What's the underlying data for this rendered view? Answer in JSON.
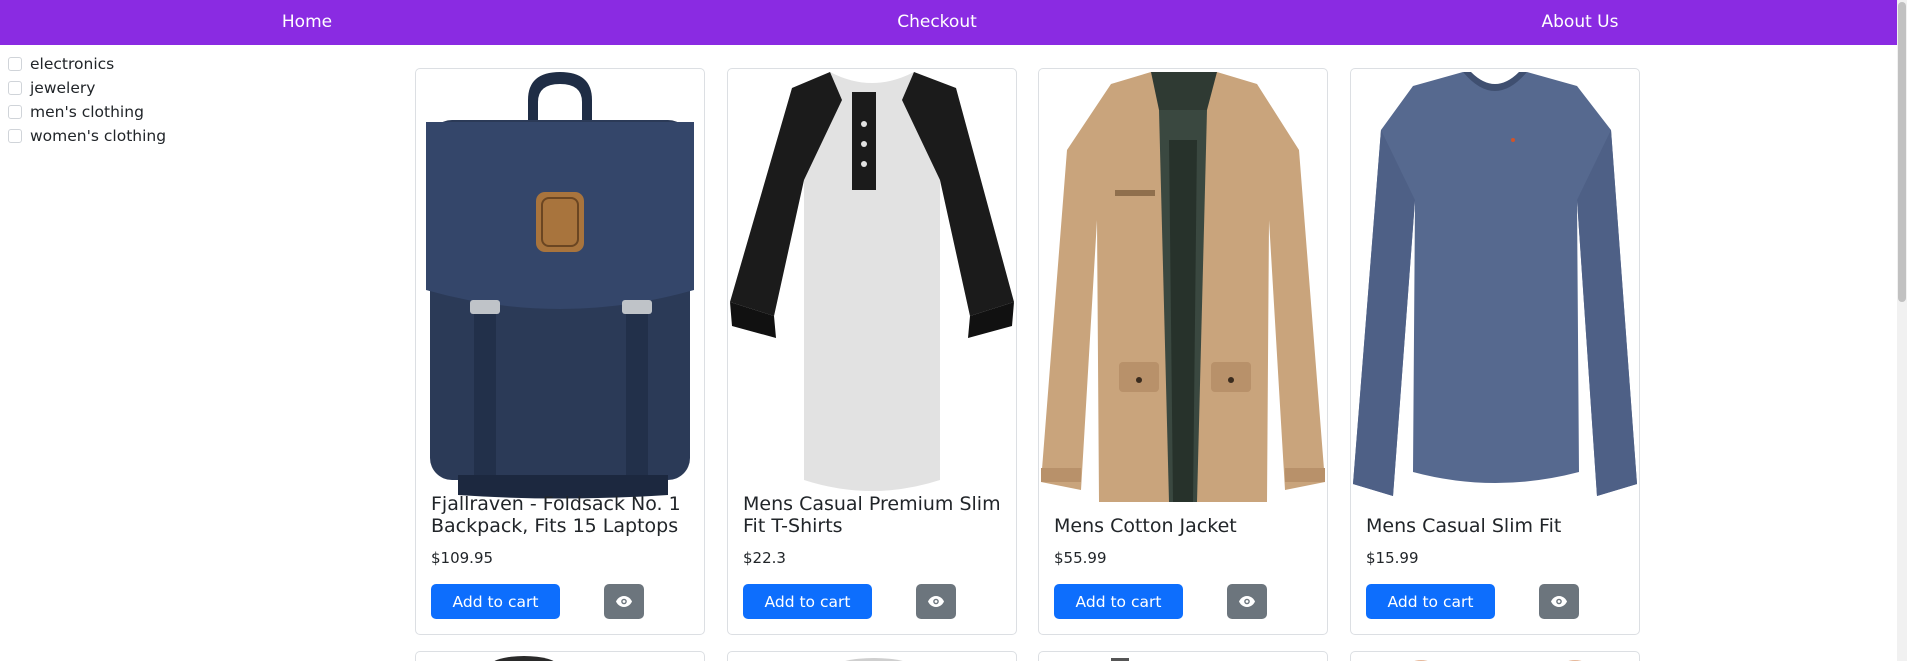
{
  "nav": {
    "home": "Home",
    "checkout": "Checkout",
    "about": "About Us"
  },
  "filters": {
    "categories": [
      "electronics",
      "jewelery",
      "men's clothing",
      "women's clothing"
    ]
  },
  "products": [
    {
      "title": "Fjallraven - Foldsack No. 1 Backpack, Fits 15 Laptops",
      "price": "$109.95",
      "cart_label": "Add to cart",
      "image": "backpack-image"
    },
    {
      "title": "Mens Casual Premium Slim Fit T-Shirts",
      "price": "$22.3",
      "cart_label": "Add to cart",
      "image": "tshirt-image"
    },
    {
      "title": "Mens Cotton Jacket",
      "price": "$55.99",
      "cart_label": "Add to cart",
      "image": "jacket-image"
    },
    {
      "title": "Mens Casual Slim Fit",
      "price": "$15.99",
      "cart_label": "Add to cart",
      "image": "longsleeve-image"
    }
  ],
  "colors": {
    "navbar": "#8a2be2",
    "primary_button": "#0d6efd",
    "secondary_button": "#6c757d"
  },
  "icons": {
    "view": "eye-icon"
  }
}
